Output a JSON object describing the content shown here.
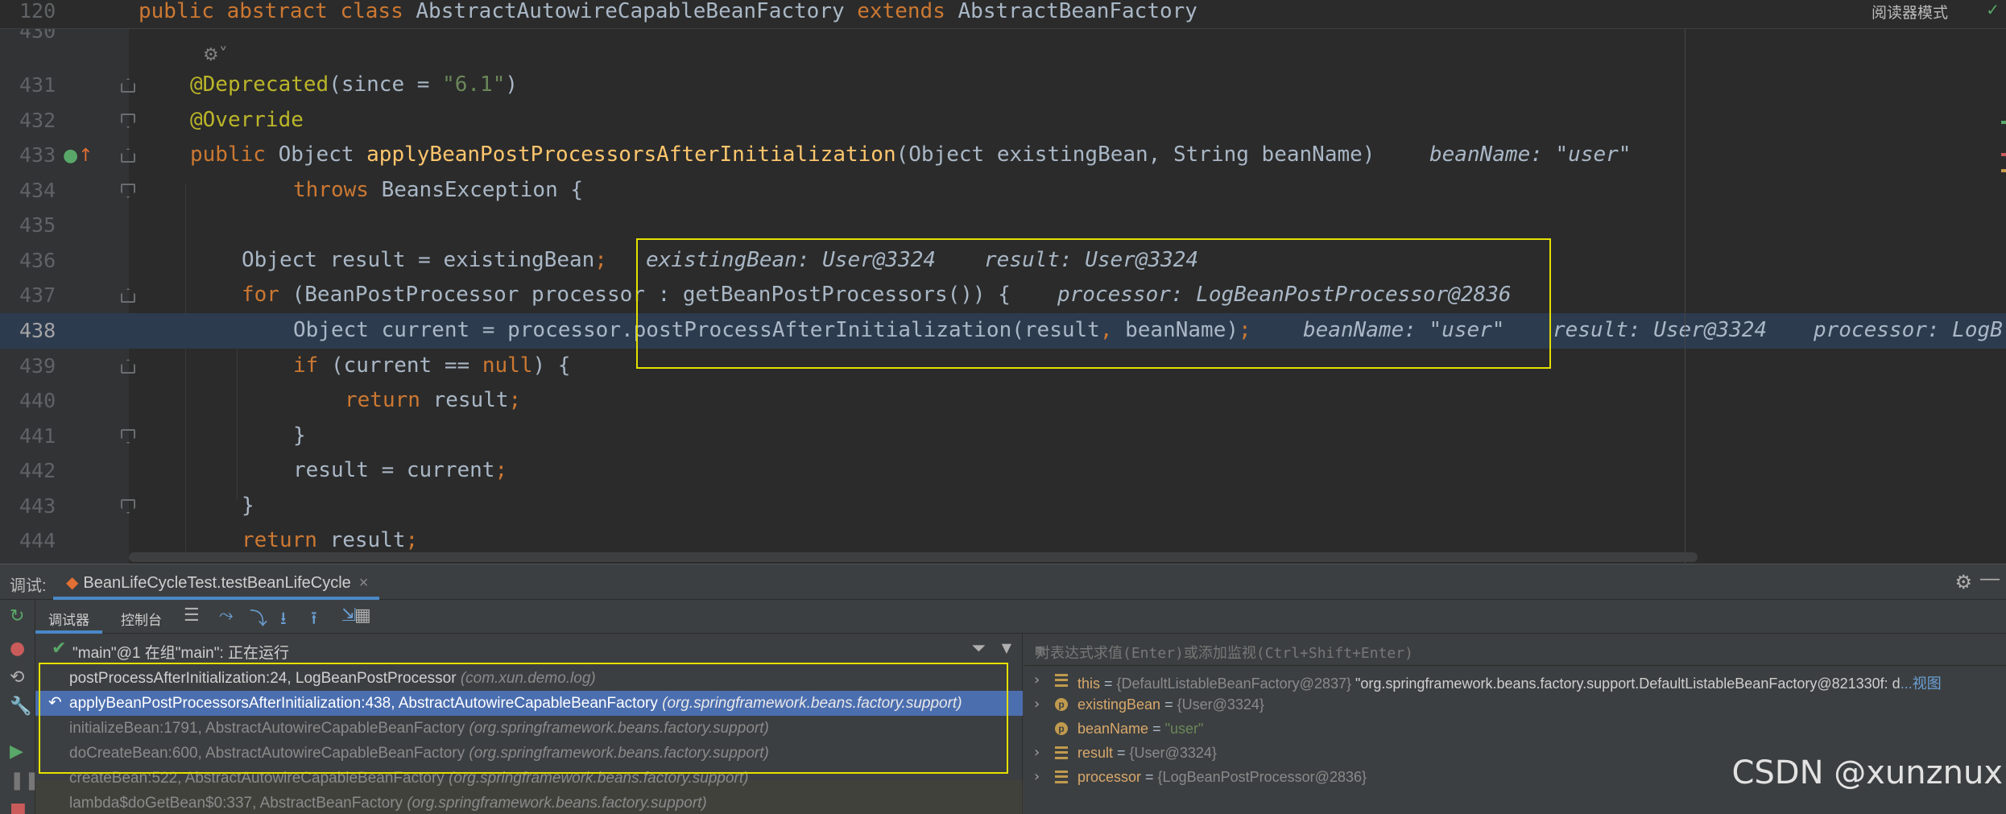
{
  "sticky": {
    "line_no": "120",
    "kw1": "public",
    "kw2": "abstract",
    "kw3": "class",
    "class_name": "AbstractAutowireCapableBeanFactory",
    "kw4": "extends",
    "super_name": "AbstractBeanFactory"
  },
  "reader_mode": "阅读器模式",
  "partial_line_no": "430",
  "code_lines": [
    {
      "ln": "431",
      "t1": "@Deprecated",
      "t2": "(since = ",
      "t3": "\"6.1\"",
      "t4": ")"
    },
    {
      "ln": "432",
      "t1": "@Override"
    },
    {
      "ln": "433",
      "t1": "public",
      "t2": " Object ",
      "t3": "applyBeanPostProcessorsAfterInitialization",
      "t4": "(Object existingBean, String beanName)",
      "hint": "beanName: \"user\""
    },
    {
      "ln": "434",
      "t1": "throws",
      "t2": " BeansException {"
    },
    {
      "ln": "435"
    },
    {
      "ln": "436",
      "t1": "Object result = existingBean",
      "t2": ";",
      "hint1": "existingBean: User@3324",
      "hint2": "result: User@3324"
    },
    {
      "ln": "437",
      "t1": "for",
      "t2": " (BeanPostProcessor processor : getBeanPostProcessors()) {",
      "hint": "processor: LogBeanPostProcessor@2836"
    },
    {
      "ln": "438",
      "t1": "Object current = processor.postProcessAfterInitialization(result",
      "t2": ",",
      "t3": " beanName)",
      "t4": ";",
      "hint1": "beanName: \"user\"",
      "hint2": "result: User@3324",
      "hint3": "processor: LogB"
    },
    {
      "ln": "439",
      "t1": "if",
      "t2": " (current == ",
      "t3": "null",
      "t4": ") {"
    },
    {
      "ln": "440",
      "t1": "return",
      "t2": " result",
      "t3": ";"
    },
    {
      "ln": "441",
      "t1": "}"
    },
    {
      "ln": "442",
      "t1": "result = current",
      "t2": ";"
    },
    {
      "ln": "443",
      "t1": "}"
    },
    {
      "ln": "444",
      "t1": "return",
      "t2": " result",
      "t3": ";"
    }
  ],
  "debug": {
    "label": "调试:",
    "session_tab": "BeanLifeCycleTest.testBeanLifeCycle",
    "tabs": [
      "调试器",
      "控制台"
    ],
    "thread_status": "\"main\"@1 在组\"main\": 正在运行",
    "watch_placeholder": "对表达式求值(Enter)或添加监视(Ctrl+Shift+Enter)",
    "frames": [
      {
        "method": "postProcessAfterInitialization:24, LogBeanPostProcessor",
        "pkg": "(com.xun.demo.log)"
      },
      {
        "method": "applyBeanPostProcessorsAfterInitialization:438, AbstractAutowireCapableBeanFactory",
        "pkg": "(org.springframework.beans.factory.support)"
      },
      {
        "method": "initializeBean:1791, AbstractAutowireCapableBeanFactory",
        "pkg": "(org.springframework.beans.factory.support)"
      },
      {
        "method": "doCreateBean:600, AbstractAutowireCapableBeanFactory",
        "pkg": "(org.springframework.beans.factory.support)"
      },
      {
        "method": "createBean:522, AbstractAutowireCapableBeanFactory",
        "pkg": "(org.springframework.beans.factory.support)"
      },
      {
        "method": "lambda$doGetBean$0:337, AbstractBeanFactory",
        "pkg": "(org.springframework.beans.factory.support)"
      }
    ],
    "variables": [
      {
        "name": "this",
        "eq": " = ",
        "type": "{DefaultListableBeanFactory@2837}",
        "value": " \"org.springframework.beans.factory.support.DefaultListableBeanFactory@821330f: d",
        "link": "...视图"
      },
      {
        "name": "existingBean",
        "eq": " = ",
        "type": "{User@3324}"
      },
      {
        "name": "beanName",
        "eq": " = ",
        "value": "\"user\""
      },
      {
        "name": "result",
        "eq": " = ",
        "type": "{User@3324}"
      },
      {
        "name": "processor",
        "eq": " = ",
        "type": "{LogBeanPostProcessor@2836}"
      }
    ]
  },
  "watermark": "CSDN @xunznux",
  "colors": {
    "keyword": "#cc7832",
    "annotation": "#bbb529",
    "string": "#6a8759",
    "method": "#ffc66d",
    "selection": "#4b6eaf",
    "highlight_box": "#e4e000"
  }
}
